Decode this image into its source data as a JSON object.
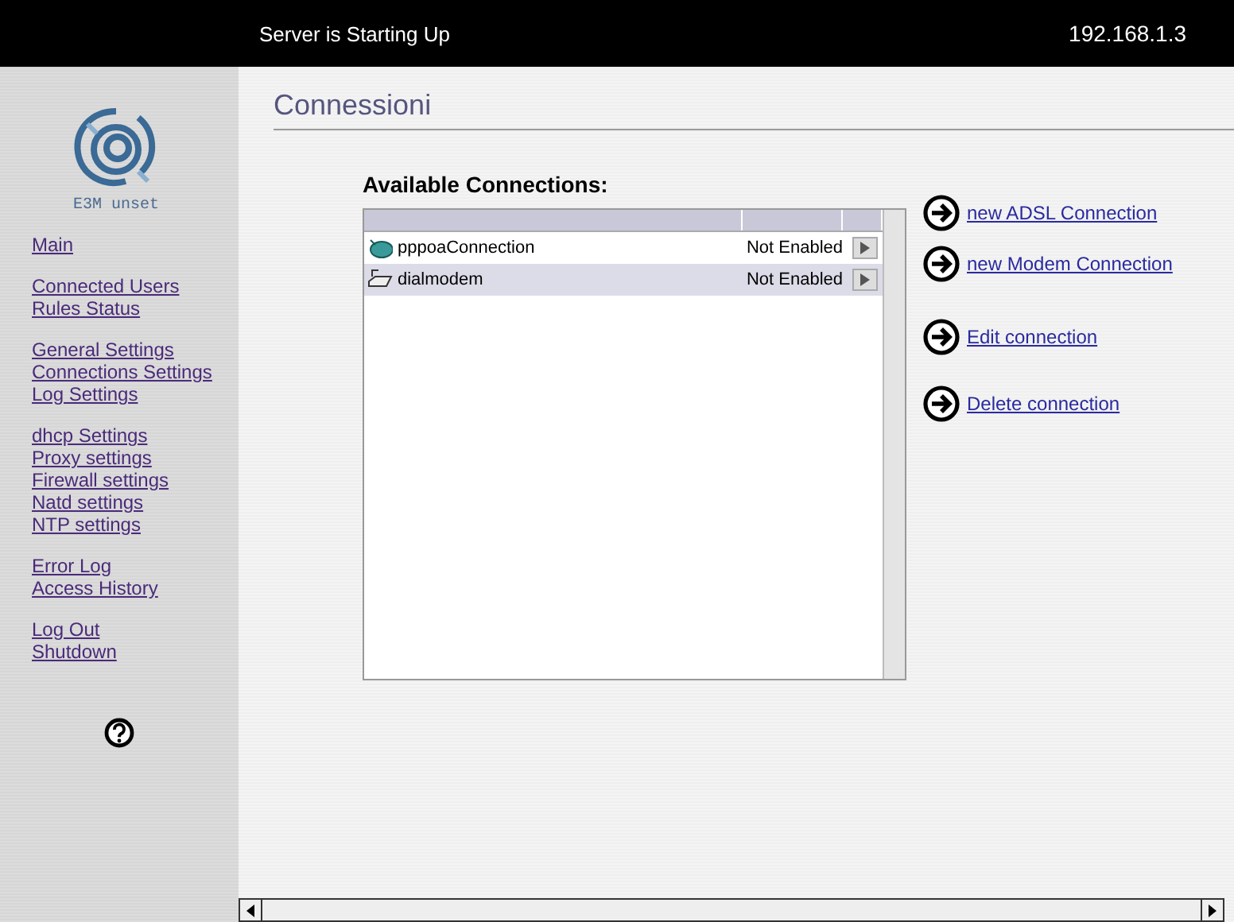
{
  "top_bar": {
    "status": "Server is Starting Up",
    "address": "192.168.1.3"
  },
  "logo": {
    "caption": "E3M unset"
  },
  "sidebar": {
    "groups": [
      [
        "Main"
      ],
      [
        "Connected Users",
        "Rules Status"
      ],
      [
        "General Settings",
        "Connections Settings",
        "Log Settings"
      ],
      [
        "dhcp Settings",
        "Proxy settings",
        "Firewall settings",
        "Natd settings",
        "NTP settings"
      ],
      [
        "Error Log",
        "Access History"
      ],
      [
        "Log Out",
        "Shutdown"
      ]
    ]
  },
  "page_title": "Connessioni",
  "connections": {
    "heading": "Available Connections:",
    "rows": [
      {
        "kind": "adsl",
        "name": "pppoaConnection",
        "status": "Not Enabled",
        "selected": false
      },
      {
        "kind": "modem",
        "name": "dialmodem",
        "status": "Not Enabled",
        "selected": true
      }
    ]
  },
  "actions": [
    {
      "label": "new ADSL Connection"
    },
    {
      "label": "new Modem Connection"
    },
    {
      "label": "Edit connection"
    },
    {
      "label": "Delete connection"
    }
  ]
}
